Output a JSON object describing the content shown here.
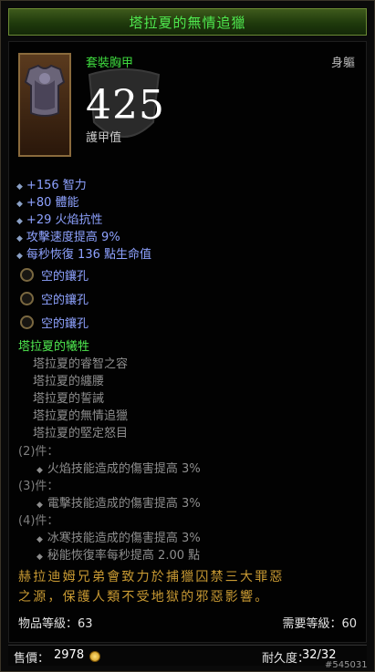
{
  "item": {
    "name": "塔拉夏的無情追獵",
    "type": "套裝胸甲",
    "slot": "身軀",
    "armor_value": "425",
    "armor_label": "護甲值"
  },
  "affixes": [
    "+156 智力",
    "+80 體能",
    "+29 火焰抗性",
    "攻擊速度提高 9%",
    "每秒恢復 136 點生命值"
  ],
  "sockets": [
    "空的鑲孔",
    "空的鑲孔",
    "空的鑲孔"
  ],
  "set": {
    "title": "塔拉夏的犧牲",
    "items": [
      "塔拉夏的睿智之容",
      "塔拉夏的纏腰",
      "塔拉夏的誓誡",
      "塔拉夏的無情追獵",
      "塔拉夏的堅定怒目"
    ],
    "bonuses": [
      {
        "header": "(2)件：",
        "lines": [
          "火焰技能造成的傷害提高 3%"
        ]
      },
      {
        "header": "(3)件：",
        "lines": [
          "電擊技能造成的傷害提高 3%"
        ]
      },
      {
        "header": "(4)件：",
        "lines": [
          "冰寒技能造成的傷害提高 3%",
          "秘能恢復率每秒提高 2.00 點"
        ]
      }
    ]
  },
  "flavor": [
    "赫拉迪姆兄弟會致力於捕獵囚禁三大罪惡",
    "之源，保護人類不受地獄的邪惡影響。"
  ],
  "item_level": "物品等級：63",
  "required_level": "需要等級：60",
  "footer": {
    "price_label": "售價：",
    "price": "2978",
    "durability_label": "耐久度：",
    "durability": "32/32"
  },
  "watermark": "#545031",
  "colors": {
    "set_green": "#4fe84f",
    "magic_blue": "#8ea2ff",
    "gold": "#c99a33"
  },
  "icons": {
    "socket": "socket-ring-icon",
    "bullet": "diamond-bullet-icon",
    "gold": "gold-coin-icon"
  }
}
